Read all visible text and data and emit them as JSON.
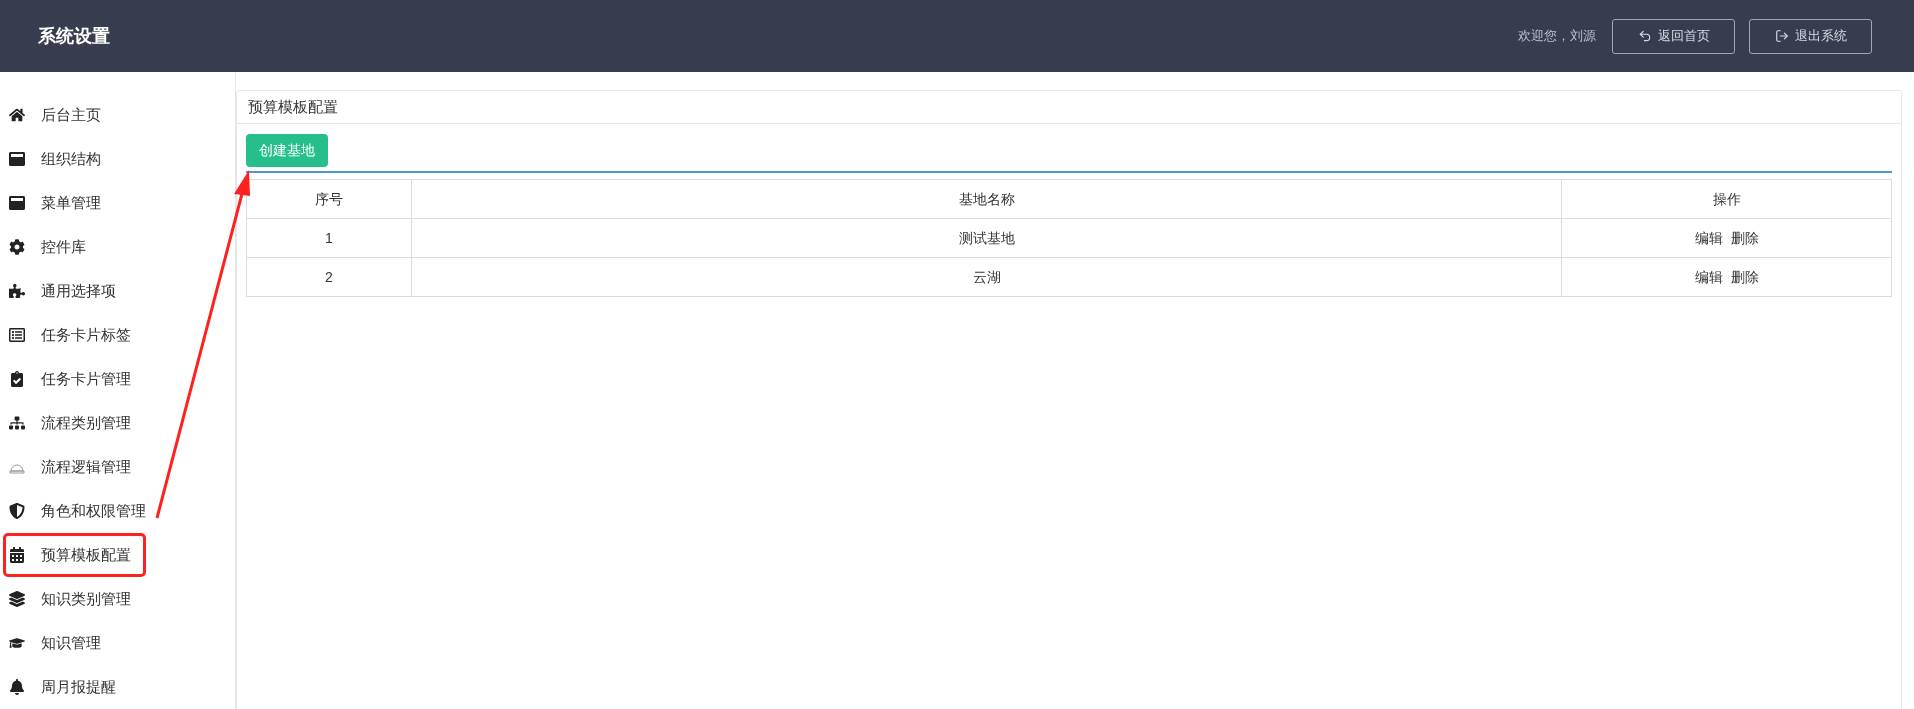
{
  "header": {
    "title": "系统设置",
    "welcome": "欢迎您，",
    "user": "刘源",
    "buttons": [
      {
        "label": "返回首页",
        "kind": "back"
      },
      {
        "label": "退出系统",
        "kind": "logout"
      }
    ]
  },
  "sidebar": {
    "items": [
      {
        "label": "后台主页",
        "highlighted": false
      },
      {
        "label": "组织结构",
        "highlighted": false
      },
      {
        "label": "菜单管理",
        "highlighted": false
      },
      {
        "label": "控件库",
        "highlighted": false
      },
      {
        "label": "通用选择项",
        "highlighted": false
      },
      {
        "label": "任务卡片标签",
        "highlighted": false
      },
      {
        "label": "任务卡片管理",
        "highlighted": false
      },
      {
        "label": "流程类别管理",
        "highlighted": false
      },
      {
        "label": "流程逻辑管理",
        "highlighted": false
      },
      {
        "label": "角色和权限管理",
        "highlighted": false
      },
      {
        "label": "预算模板配置",
        "highlighted": true
      },
      {
        "label": "知识类别管理",
        "highlighted": false
      },
      {
        "label": "知识管理",
        "highlighted": false
      },
      {
        "label": "周月报提醒",
        "highlighted": false
      }
    ]
  },
  "panel": {
    "title": "预算模板配置",
    "create_button": "创建基地",
    "table": {
      "columns": [
        "序号",
        "基地名称",
        "操作"
      ],
      "rows": [
        {
          "index": "1",
          "name": "测试基地",
          "actions": [
            "编辑",
            "删除"
          ]
        },
        {
          "index": "2",
          "name": "云湖",
          "actions": [
            "编辑",
            "删除"
          ]
        }
      ]
    }
  }
}
